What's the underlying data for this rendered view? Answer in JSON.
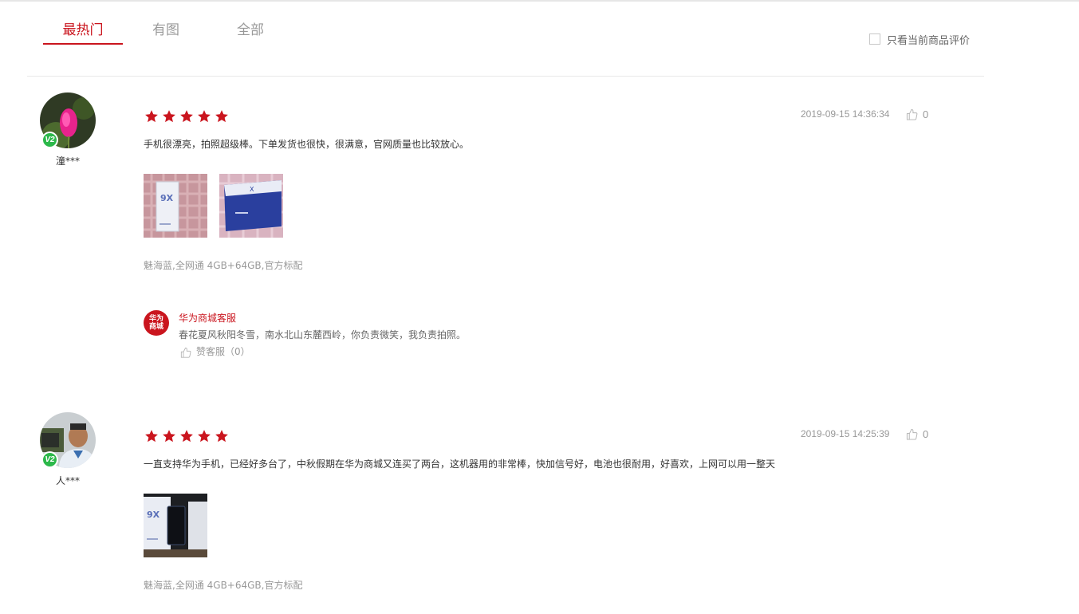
{
  "tabs": [
    {
      "label": "最热门",
      "active": true
    },
    {
      "label": "有图",
      "active": false
    },
    {
      "label": "全部",
      "active": false
    }
  ],
  "filter": {
    "only_current_label": "只看当前商品评价",
    "checked": false
  },
  "colors": {
    "accent": "#ca151e",
    "star": "#ca151e",
    "vip": "#2cb84a",
    "muted": "#999999"
  },
  "reviews": [
    {
      "username": "潼***",
      "vip_badge": "V2",
      "rating": 5,
      "time": "2019-09-15 14:36:34",
      "likes": "0",
      "content": "手机很漂亮，拍照超级棒。下单发货也很快，很满意，官网质量也比较放心。",
      "spec": "魅海蓝,全网通 4GB+64GB,官方标配",
      "photo_count": 2,
      "reply": {
        "logo_text": [
          "华为",
          "商城"
        ],
        "name": "华为商城客服",
        "text": "春花夏风秋阳冬雪，南水北山东麓西岭，你负责微笑，我负责拍照。",
        "like_label": "赞客服（0）"
      }
    },
    {
      "username": "人***",
      "vip_badge": "V2",
      "rating": 5,
      "time": "2019-09-15 14:25:39",
      "likes": "0",
      "content": "一直支持华为手机，已经好多台了，中秋假期在华为商城又连买了两台，这机器用的非常棒，快加信号好，电池也很耐用，好喜欢，上网可以用一整天",
      "spec": "魅海蓝,全网通 4GB+64GB,官方标配",
      "photo_count": 1
    }
  ]
}
